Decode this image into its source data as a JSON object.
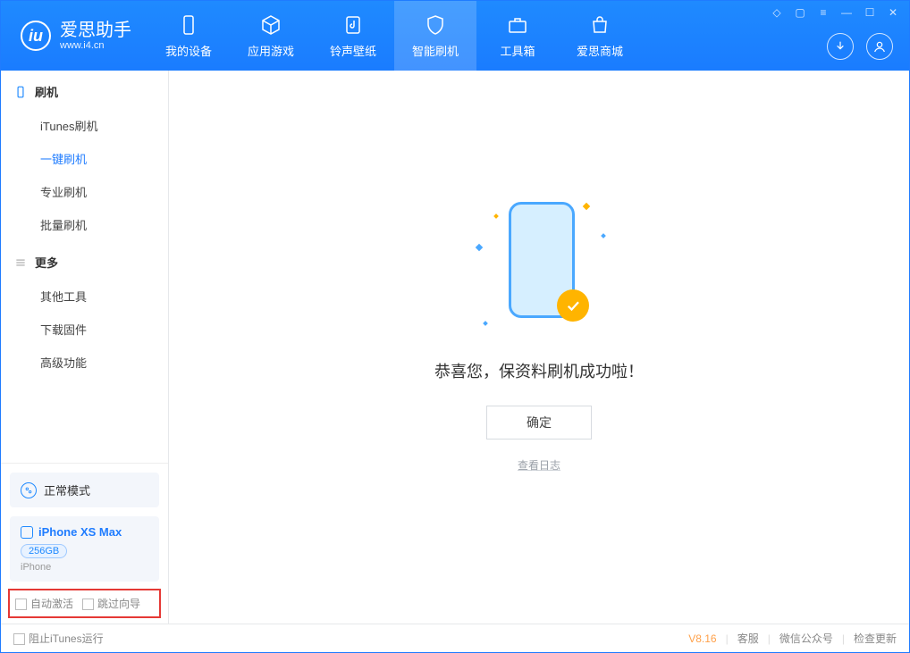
{
  "app": {
    "name": "爱思助手",
    "site": "www.i4.cn"
  },
  "tabs": [
    {
      "label": "我的设备"
    },
    {
      "label": "应用游戏"
    },
    {
      "label": "铃声壁纸"
    },
    {
      "label": "智能刷机"
    },
    {
      "label": "工具箱"
    },
    {
      "label": "爱思商城"
    }
  ],
  "sidebar": {
    "section1": "刷机",
    "items1": [
      "iTunes刷机",
      "一键刷机",
      "专业刷机",
      "批量刷机"
    ],
    "section2": "更多",
    "items2": [
      "其他工具",
      "下载固件",
      "高级功能"
    ]
  },
  "mode": {
    "label": "正常模式"
  },
  "device": {
    "name": "iPhone XS Max",
    "storage": "256GB",
    "type": "iPhone"
  },
  "options": {
    "auto_activate": "自动激活",
    "skip_guide": "跳过向导"
  },
  "main": {
    "message": "恭喜您，保资料刷机成功啦！",
    "ok": "确定",
    "view_log": "查看日志"
  },
  "footer": {
    "block_itunes": "阻止iTunes运行",
    "version": "V8.16",
    "support": "客服",
    "wechat": "微信公众号",
    "update": "检查更新"
  }
}
